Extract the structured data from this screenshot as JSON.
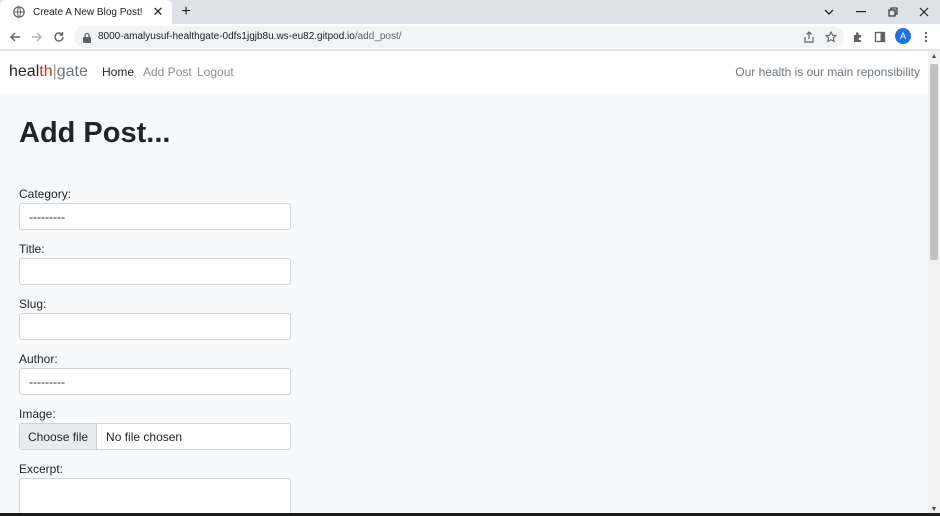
{
  "browser": {
    "tab_title": "Create A New Blog Post!",
    "tab_close": "✕",
    "new_tab": "+",
    "url_host": "8000-amalyusuf-healthgate-0dfs1jgjb8u.ws-eu82.gitpod.io",
    "url_path": "/add_post/",
    "profile_initial": "A"
  },
  "navbar": {
    "brand_part1": "heal",
    "brand_part2": "th",
    "brand_sep": "|",
    "brand_part3": "gate",
    "links": [
      "Home",
      "Add Post",
      "Logout"
    ],
    "tagline": "Our health is our main reponsibility"
  },
  "form": {
    "title": "Add Post...",
    "category_label": "Category:",
    "category_value": "---------",
    "title_label": "Title:",
    "title_value": "",
    "slug_label": "Slug:",
    "slug_value": "",
    "author_label": "Author:",
    "author_value": "---------",
    "image_label": "Image:",
    "image_button": "Choose file",
    "image_status": "No file chosen",
    "excerpt_label": "Excerpt:"
  },
  "colors": {
    "brand_accent": "#c0392b",
    "page_bg": "#f8f9fa",
    "profile": "#1a73e8"
  }
}
